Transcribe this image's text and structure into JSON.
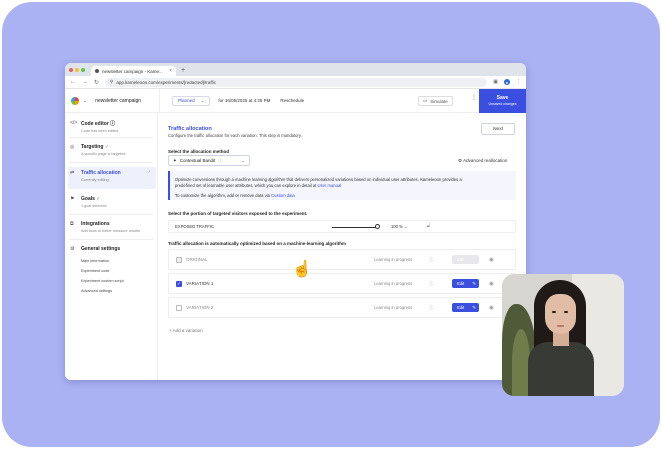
{
  "browser": {
    "tab_title": "newsletter campaign - Kame...",
    "new_tab": "+",
    "url": "app.kameleoon.com/experiments/[redacted]/traffic"
  },
  "header": {
    "campaign_name": "newsletter campaign",
    "status": "Planned",
    "schedule": "for 16/05/2025 at 4:25 PM",
    "reschedule": "Reschedule",
    "simulate": "Simulate",
    "save_label": "Save",
    "save_sub": "Unsaved changes"
  },
  "sidebar": {
    "items": [
      {
        "title": "Code editor",
        "subtitle": "Code has been edited"
      },
      {
        "title": "Targeting",
        "subtitle": "A specific page is targeted"
      },
      {
        "title": "Traffic allocation",
        "subtitle": "Currently editing"
      },
      {
        "title": "Goals",
        "subtitle": "1 goal selected"
      },
      {
        "title": "Integrations",
        "subtitle": "Add tools to better measure results"
      }
    ],
    "general_settings": {
      "title": "General settings",
      "links": [
        "Main information",
        "Experiment code",
        "Experiment custom script",
        "Advanced settings"
      ]
    }
  },
  "main": {
    "title": "Traffic allocation",
    "subtitle": "Configure the traffic allocation for each variation. This step is mandatory.",
    "next": "Next",
    "method_label": "Select the allocation method",
    "method_value": "Contextual Bandit",
    "advanced_reallocation": "Advanced reallocation",
    "info_line1": "Optimize conversions through a machine learning algorithm that delivers personalized variations based on individual user attributes. Kameleoon provides a",
    "info_line2_a": "predefined set of learnable user attributes, which you can explore in detail at ",
    "info_line2_link": "User manual",
    "info_line3_a": "To customize the algorithm, add or remove data via ",
    "info_line3_link": "Custom data",
    "exposure_label": "Select the portion of targeted visitors exposed to the experiment.",
    "exposed_traffic": "EXPOSED TRAFFIC",
    "exposed_value": "100 %",
    "auto_label": "Traffic allocation is automatically optimized based on a machine-learning algorithm",
    "variations": [
      {
        "name": "ORIGINAL",
        "status": "Learning in progress",
        "edit": "Edit"
      },
      {
        "name": "VARIATION 1",
        "status": "Learning in progress",
        "edit": "Edit"
      },
      {
        "name": "VARIATION 2",
        "status": "Learning in progress",
        "edit": "Edit"
      }
    ],
    "add_variation": "+ Add a variation"
  },
  "colors": {
    "accent": "#3a4fe0",
    "frame": "#aab2f3"
  },
  "icons": [
    "code-icon",
    "target-icon",
    "traffic-icon",
    "goal-icon",
    "integration-icon",
    "gear-icon",
    "eye-icon",
    "info-icon",
    "lock-icon",
    "pencil-icon",
    "hand-cursor-icon"
  ]
}
